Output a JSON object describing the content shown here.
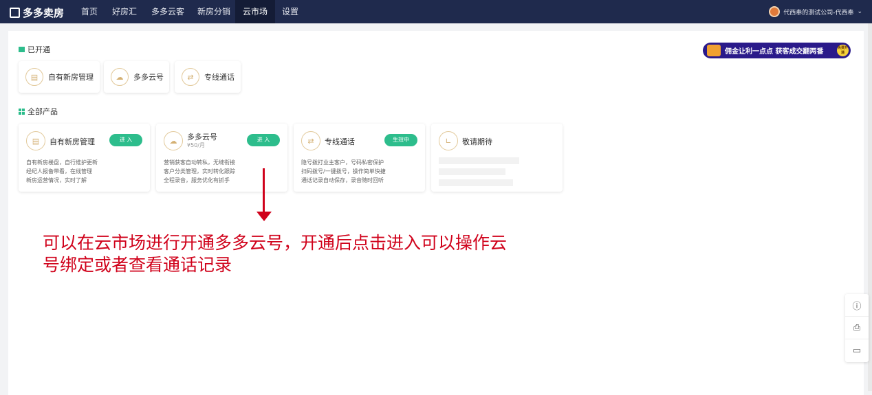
{
  "nav": {
    "logo": "多多卖房",
    "items": [
      "首页",
      "好房汇",
      "多多云客",
      "新房分销",
      "云市场",
      "设置"
    ],
    "active": "云市场",
    "user": "代西奉的测试公司-代西奉"
  },
  "banner": {
    "text": "佣金让利一点点 获客成交翻两番",
    "badge": "免费开通"
  },
  "opened": {
    "title": "已开通",
    "items": [
      "自有新房管理",
      "多多云号",
      "专线通话"
    ]
  },
  "all": {
    "title": "全部产品",
    "cards": [
      {
        "title": "自有新房管理",
        "button": "进 入",
        "desc": [
          "自有新房楼盘，自行维护更新",
          "经纪人报备带看，在线管理",
          "新房运营情况，实时了解"
        ]
      },
      {
        "title": "多多云号",
        "price": "¥50/月",
        "button": "进 入",
        "desc": [
          "营销获客自动转私，无缝衔接",
          "客户分类管理，实时转化跟踪",
          "全程录音，服务优化有抓手"
        ]
      },
      {
        "title": "专线通话",
        "button": "生效中",
        "desc": [
          "隐号拨打业主客户，号码私密保护",
          "扫码拨号/一键拨号，操作简单快捷",
          "通话记录自动保存，录音随时回听"
        ]
      },
      {
        "title": "敬请期待"
      }
    ]
  },
  "annotation": "可以在云市场进行开通多多云号，开通后点击进入可以操作云号绑定或者查看通话记录",
  "colors": {
    "nav": "#1f2a4d",
    "accent": "#2dbd8c",
    "annotation": "#d0021b"
  }
}
